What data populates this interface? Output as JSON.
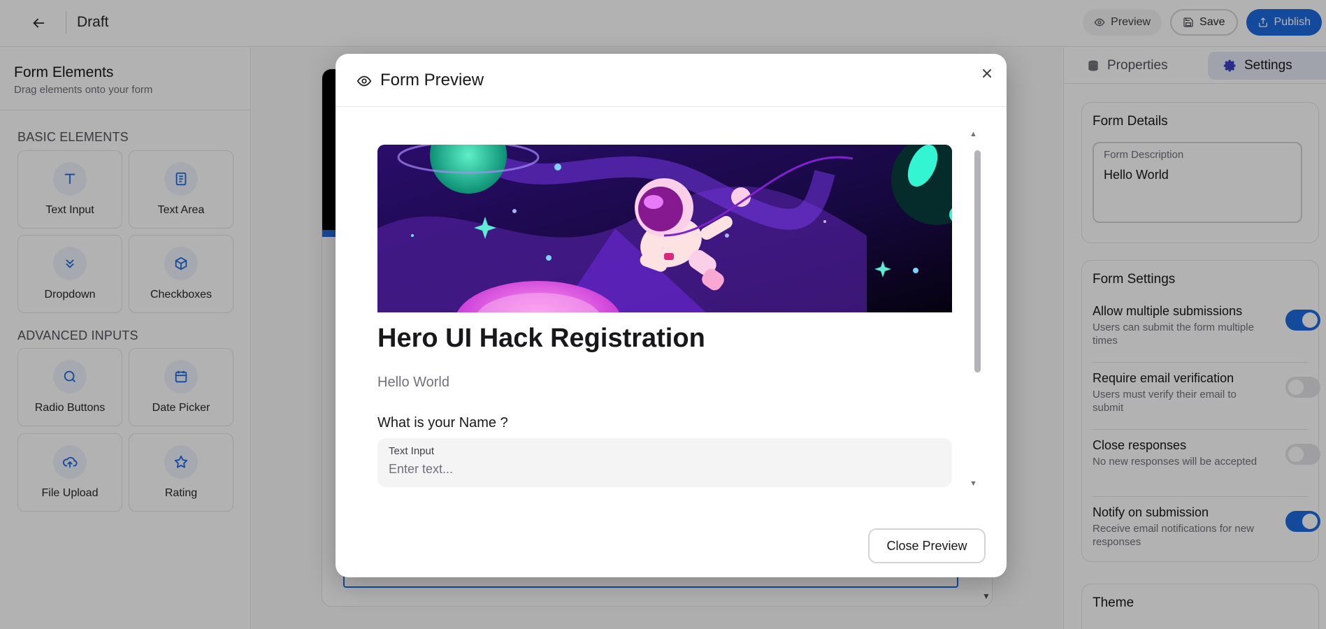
{
  "topbar": {
    "title": "Draft",
    "preview_label": "Preview",
    "save_label": "Save",
    "publish_label": "Publish"
  },
  "sidebar": {
    "title": "Form Elements",
    "subtitle": "Drag elements onto your form",
    "basic_heading": "BASIC ELEMENTS",
    "advanced_heading": "ADVANCED INPUTS",
    "basic_elements": [
      {
        "label": "Text Input",
        "icon": "text-icon"
      },
      {
        "label": "Text Area",
        "icon": "document-icon"
      },
      {
        "label": "Dropdown",
        "icon": "chevron-double-down-icon"
      },
      {
        "label": "Checkboxes",
        "icon": "cube-icon"
      }
    ],
    "advanced_elements": [
      {
        "label": "Radio Buttons",
        "icon": "circle-icon"
      },
      {
        "label": "Date Picker",
        "icon": "calendar-icon"
      },
      {
        "label": "File Upload",
        "icon": "cloud-upload-icon"
      },
      {
        "label": "Rating",
        "icon": "star-icon"
      }
    ]
  },
  "right_panel": {
    "tabs": [
      {
        "label": "Properties",
        "icon": "database-icon",
        "active": false
      },
      {
        "label": "Settings",
        "icon": "gear-icon",
        "active": true
      }
    ],
    "form_details": {
      "title": "Form Details",
      "description_label": "Form Description",
      "description_value": "Hello World"
    },
    "form_settings": {
      "title": "Form Settings",
      "items": [
        {
          "title": "Allow multiple submissions",
          "desc": "Users can submit the form multiple times",
          "enabled": true
        },
        {
          "title": "Require email verification",
          "desc": "Users must verify their email to submit",
          "enabled": false
        },
        {
          "title": "Close responses",
          "desc": "No new responses will be accepted",
          "enabled": false
        },
        {
          "title": "Notify on submission",
          "desc": "Receive email notifications for new responses",
          "enabled": true
        }
      ]
    },
    "theme_title": "Theme"
  },
  "modal": {
    "title": "Form Preview",
    "form_title": "Hero UI Hack Registration",
    "form_description": "Hello World",
    "question_label": "What is your Name ?",
    "input_label": "Text Input",
    "input_placeholder": "Enter text...",
    "close_button": "Close Preview"
  },
  "colors": {
    "accent": "#1d6be0",
    "overlay": "rgba(0,0,0,0.30)",
    "banner_dark": "#1a0b3d",
    "banner_purple": "#5b21b6",
    "banner_pink": "#e879f9"
  }
}
